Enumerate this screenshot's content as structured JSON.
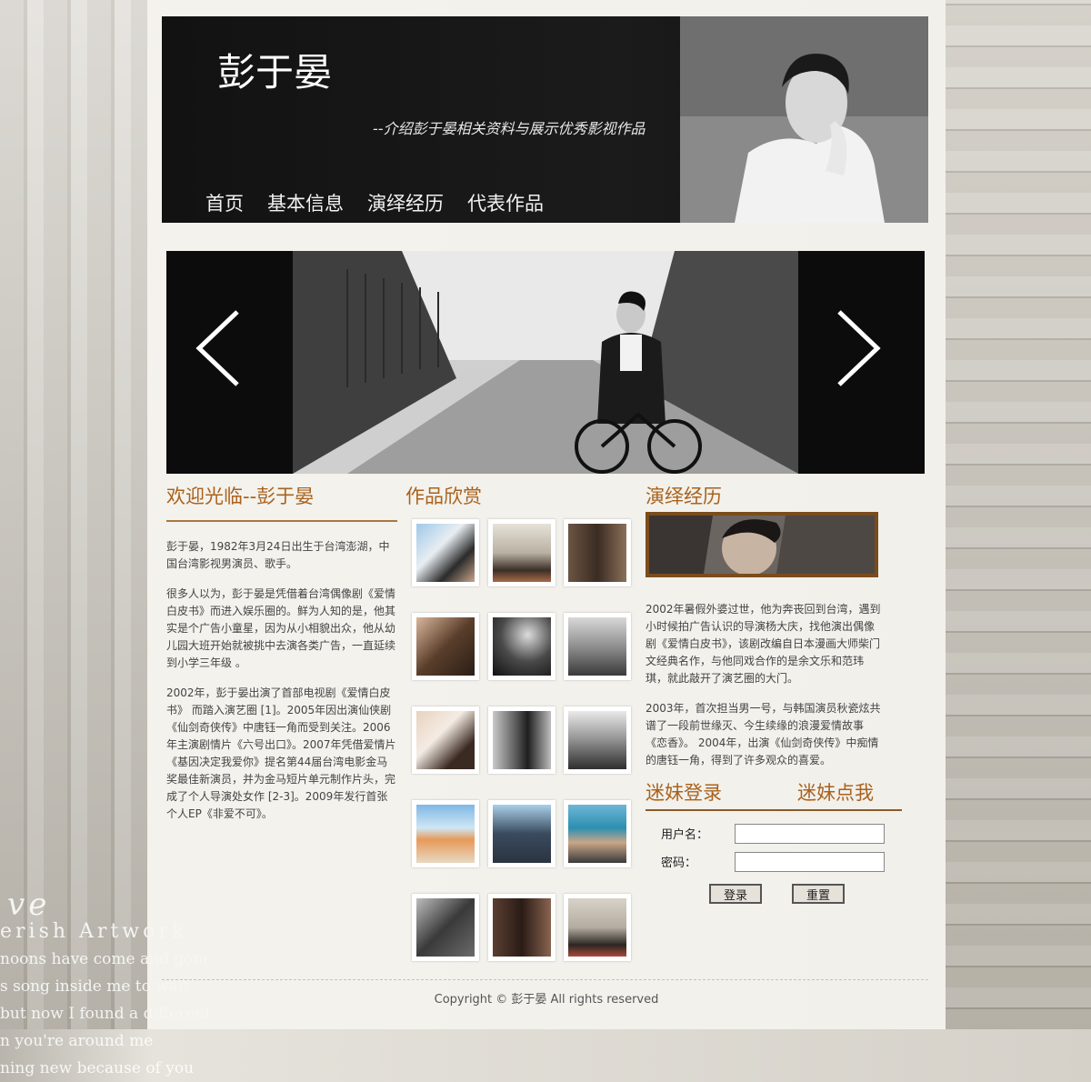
{
  "header": {
    "title": "彭于晏",
    "subtitle": "--介绍彭于晏相关资料与展示优秀影视作品",
    "nav": [
      "首页",
      "基本信息",
      "演绎经历",
      "代表作品"
    ]
  },
  "slider": {
    "prev_icon": "chevron-left-icon",
    "next_icon": "chevron-right-icon"
  },
  "welcome": {
    "title": "欢迎光临--彭于晏",
    "paragraphs": [
      "彭于晏，1982年3月24日出生于台湾澎湖，中国台湾影视男演员、歌手。",
      "很多人以为，彭于晏是凭借着台湾偶像剧《爱情白皮书》而进入娱乐圈的。鲜为人知的是，他其实是个广告小童星，因为从小相貌出众，他从幼儿园大班开始就被挑中去演各类广告，一直延续到小学三年级 。",
      "2002年，彭于晏出演了首部电视剧《爱情白皮书》 而踏入演艺圈 [1]。2005年因出演仙侠剧《仙剑奇侠传》中唐钰一角而受到关注。2006年主演剧情片《六号出口》。2007年凭借爱情片《基因决定我爱你》提名第44届台湾电影金马奖最佳新演员，并为金马短片单元制作片头，完成了个人导演处女作 [2-3]。2009年发行首张个人EP《非爱不可》。"
    ]
  },
  "works": {
    "title": "作品欣赏",
    "thumb_count": 15
  },
  "experience": {
    "title": "演绎经历",
    "paragraphs": [
      "2002年暑假外婆过世，他为奔丧回到台湾，遇到小时候拍广告认识的导演杨大庆，找他演出偶像剧《爱情白皮书》，该剧改编自日本漫画大师柴门文经典名作，与他同戏合作的是余文乐和范玮琪，就此敲开了演艺圈的大门。",
      "2003年，首次担当男一号，与韩国演员秋瓷炫共谱了一段前世缘灭、今生续缘的浪漫爱情故事《恋香》。 2004年，出演《仙剑奇侠传》中痴情的唐钰一角，得到了许多观众的喜爱。"
    ]
  },
  "login": {
    "title": "迷妹登录",
    "link": "迷妹点我",
    "username_label": "用户名：",
    "password_label": "密码：",
    "username_value": "",
    "password_value": "",
    "submit_label": "登录",
    "reset_label": "重置"
  },
  "background": {
    "script_lines": [
      "ve",
      "erish Artwork",
      "noons have come and gone all alone",
      "s song inside me to wait",
      "but now I found a different sound",
      "n you're around me",
      "ning new because of you"
    ]
  },
  "footer": {
    "copyright": "Copyright © 彭于晏 All rights reserved"
  },
  "colors": {
    "accent": "#a9621d",
    "rule": "#a9773f",
    "photo_frame": "#7b4c1c"
  }
}
